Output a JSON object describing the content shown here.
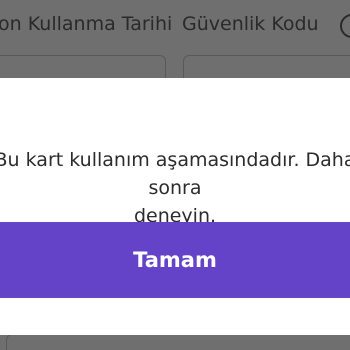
{
  "background_form": {
    "expiry_label": "Son Kullanma Tarihi",
    "security_code_label": "Güvenlik Kodu",
    "info_icon": "info-circle-icon"
  },
  "dialog": {
    "message_line1": "Bu kart kullanım aşamasındadır. Daha sonra",
    "message_line2": "deneyin.",
    "ok_label": "Tamam"
  },
  "colors": {
    "accent": "#6443c9",
    "overlay": "#6f6f6f",
    "dialog_bg": "#ffffff"
  }
}
